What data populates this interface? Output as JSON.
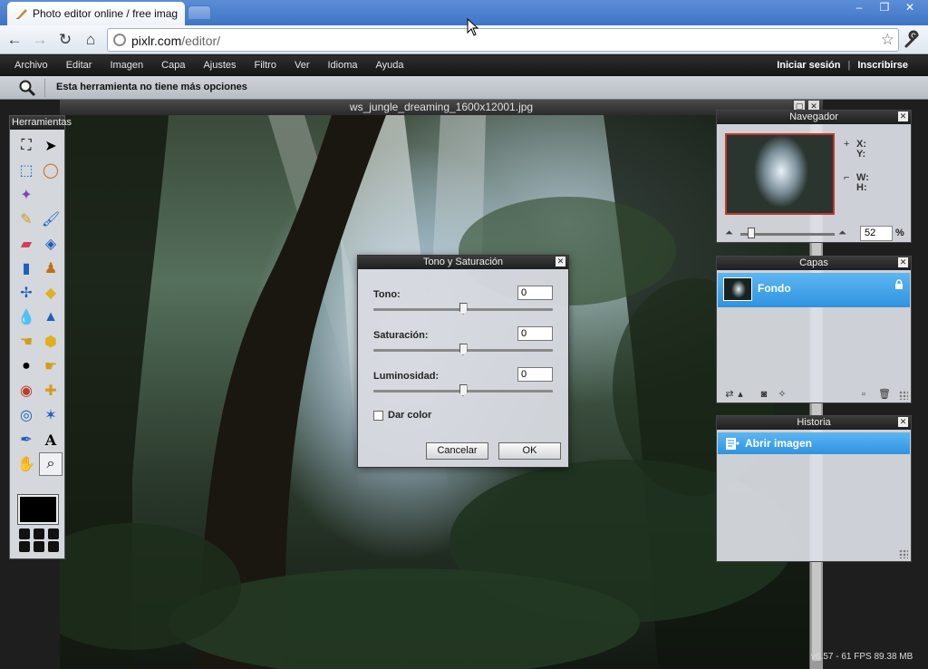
{
  "browser": {
    "tab_title": "Photo editor online / free imag",
    "url_host": "pixlr.com",
    "url_path": "/editor/",
    "window_buttons": [
      "–",
      "❐",
      "✕"
    ]
  },
  "menubar": {
    "items": [
      "Archivo",
      "Editar",
      "Imagen",
      "Capa",
      "Ajustes",
      "Filtro",
      "Ver",
      "Idioma",
      "Ayuda"
    ],
    "login": "Iniciar sesión",
    "separator": "|",
    "signup": "Inscribirse"
  },
  "options_bar": {
    "text": "Esta herramienta no tiene más opciones"
  },
  "document": {
    "title": "ws_jungle_dreaming_1600x12001.jpg"
  },
  "tools_panel": {
    "title": "Herramientas"
  },
  "navigator": {
    "title": "Navegador",
    "x_label": "X:",
    "y_label": "Y:",
    "w_label": "W:",
    "h_label": "H:",
    "zoom_value": "52",
    "zoom_unit": "%"
  },
  "layers": {
    "title": "Capas",
    "layer_name": "Fondo"
  },
  "history": {
    "title": "Historia",
    "entry": "Abrir imagen"
  },
  "dialog": {
    "title": "Tono y Saturación",
    "hue_label": "Tono:",
    "hue_value": "0",
    "hue_level": 0.5,
    "saturation_label": "Saturación:",
    "saturation_value": "0",
    "saturation_level": 0.5,
    "lightness_label": "Luminosidad:",
    "lightness_value": "0",
    "lightness_level": 0.5,
    "colorize_label": "Dar color",
    "colorize_checked": false,
    "cancel_label": "Cancelar",
    "ok_label": "OK"
  },
  "status": {
    "text": "v6.57 - 61 FPS 89.38 MB"
  },
  "colors": {
    "accent_blue": "#2f93df",
    "menubar_bg": "#1e1e1e",
    "chrome_blue": "#3f74c6"
  }
}
